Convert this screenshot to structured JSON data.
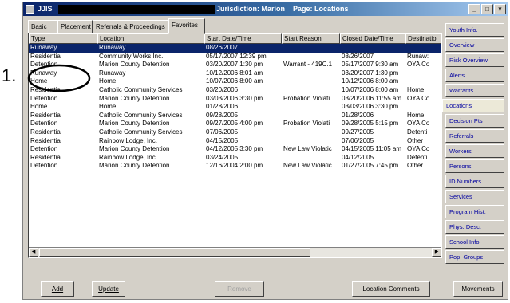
{
  "window": {
    "app_name": "JJIS",
    "title_rest": "Jurisdiction: Marion    Page: Locations",
    "buttons": [
      "_",
      "□",
      "×"
    ]
  },
  "tabs": [
    "Basic",
    "Placement",
    "Referrals & Proceedings",
    "Favorites"
  ],
  "grid": {
    "columns": [
      "Type",
      "Location",
      "Start Date/Time",
      "Start Reason",
      "Closed Date/Time",
      "Destinatio"
    ],
    "rows": [
      {
        "type": "Runaway",
        "location": "Runaway",
        "start": "08/26/2007",
        "reason": "",
        "closed": "",
        "dest": "",
        "selected": true
      },
      {
        "type": "Residential",
        "location": "Community Works Inc.",
        "start": "05/17/2007 12:39 pm",
        "reason": "",
        "closed": "08/26/2007",
        "dest": "Runaw:"
      },
      {
        "type": "Detention",
        "location": "Marion County Detention",
        "start": "03/20/2007 1:30 pm",
        "reason": "Warrant - 419C.1",
        "closed": "05/17/2007 9:30 am",
        "dest": "OYA Co"
      },
      {
        "type": "Runaway",
        "location": "Runaway",
        "start": "10/12/2006 8:01 am",
        "reason": "",
        "closed": "03/20/2007 1:30 pm",
        "dest": ""
      },
      {
        "type": "Home",
        "location": "Home",
        "start": "10/07/2006 8:00 am",
        "reason": "",
        "closed": "10/12/2006 8:00 am",
        "dest": ""
      },
      {
        "type": "Residential",
        "location": "Catholic Community Services",
        "start": "03/20/2006",
        "reason": "",
        "closed": "10/07/2006 8:00 am",
        "dest": "Home"
      },
      {
        "type": "Detention",
        "location": "Marion County Detention",
        "start": "03/03/2006 3:30 pm",
        "reason": "Probation Violati",
        "closed": "03/20/2006 11:55 am",
        "dest": "OYA Co"
      },
      {
        "type": "Home",
        "location": "Home",
        "start": "01/28/2006",
        "reason": "",
        "closed": "03/03/2006 3:30 pm",
        "dest": ""
      },
      {
        "type": "Residential",
        "location": "Catholic Community Services",
        "start": "09/28/2005",
        "reason": "",
        "closed": "01/28/2006",
        "dest": "Home"
      },
      {
        "type": "Detention",
        "location": "Marion County Detention",
        "start": "09/27/2005 4:00 pm",
        "reason": "Probation Violati",
        "closed": "09/28/2005 5:15 pm",
        "dest": "OYA Co"
      },
      {
        "type": "Residential",
        "location": "Catholic Community Services",
        "start": "07/06/2005",
        "reason": "",
        "closed": "09/27/2005",
        "dest": "Detenti"
      },
      {
        "type": "Residential",
        "location": "Rainbow Lodge, Inc.",
        "start": "04/15/2005",
        "reason": "",
        "closed": "07/06/2005",
        "dest": "Other"
      },
      {
        "type": "Detention",
        "location": "Marion County Detention",
        "start": "04/12/2005 3:30 pm",
        "reason": "New Law Violatic",
        "closed": "04/15/2005 11:05 am",
        "dest": "OYA Co"
      },
      {
        "type": "Residential",
        "location": "Rainbow Lodge, Inc.",
        "start": "03/24/2005",
        "reason": "",
        "closed": "04/12/2005",
        "dest": "Detenti"
      },
      {
        "type": "Detention",
        "location": "Marion County Detention",
        "start": "12/16/2004 2:00 pm",
        "reason": "New Law Violatic",
        "closed": "01/27/2005 7:45 pm",
        "dest": "Other"
      }
    ]
  },
  "side_nav": [
    "Youth Info.",
    "Overview",
    "Risk Overview",
    "Alerts",
    "Warrants",
    "Locations",
    "Decision Pts",
    "Referrals",
    "Workers",
    "Persons",
    "ID Numbers",
    "Services",
    "Program Hist.",
    "Phys. Desc.",
    "School Info",
    "Pop. Groups"
  ],
  "side_nav_active": "Locations",
  "bottom": {
    "add": "Add",
    "update": "Update",
    "remove": "Remove",
    "location_comments": "Location Comments",
    "movements": "Movements"
  },
  "annotation": {
    "label": "1."
  }
}
